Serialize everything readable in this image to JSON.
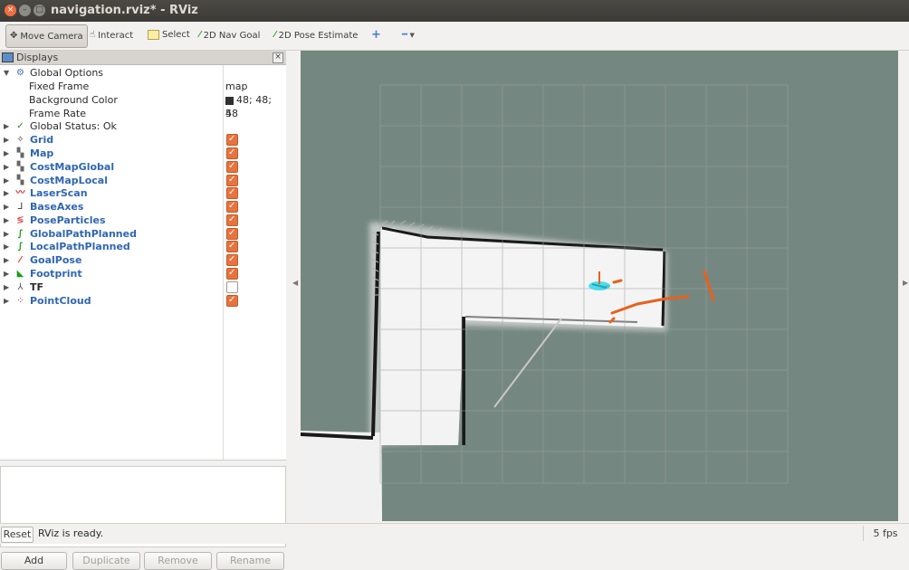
{
  "window": {
    "title": "navigation.rviz* - RViz"
  },
  "toolbar": {
    "move_camera": "Move Camera",
    "interact": "Interact",
    "select": "Select",
    "nav_goal": "2D Nav Goal",
    "pose_estimate": "2D Pose Estimate"
  },
  "panel": {
    "title": "Displays",
    "global_options": {
      "label": "Global Options",
      "fixed_frame_label": "Fixed Frame",
      "fixed_frame_value": "map",
      "bg_color_label": "Background Color",
      "bg_color_value": "48; 48; 48",
      "frame_rate_label": "Frame Rate",
      "frame_rate_value": "5"
    },
    "global_status": "Global Status: Ok",
    "displays": [
      {
        "label": "Grid",
        "checked": true
      },
      {
        "label": "Map",
        "checked": true
      },
      {
        "label": "CostMapGlobal",
        "checked": true
      },
      {
        "label": "CostMapLocal",
        "checked": true
      },
      {
        "label": "LaserScan",
        "checked": true
      },
      {
        "label": "BaseAxes",
        "checked": true
      },
      {
        "label": "PoseParticles",
        "checked": true
      },
      {
        "label": "GlobalPathPlanned",
        "checked": true
      },
      {
        "label": "LocalPathPlanned",
        "checked": true
      },
      {
        "label": "GoalPose",
        "checked": true
      },
      {
        "label": "Footprint",
        "checked": true
      },
      {
        "label": "TF",
        "checked": false
      },
      {
        "label": "PointCloud",
        "checked": true
      }
    ],
    "buttons": {
      "add": "Add",
      "duplicate": "Duplicate",
      "remove": "Remove",
      "rename": "Rename"
    }
  },
  "statusbar": {
    "reset": "Reset",
    "message": "RViz is ready.",
    "fps": "5 fps"
  },
  "colors": {
    "accent": "#e8733e",
    "view_bg": "#758781",
    "map_free": "#f4f4f4",
    "display_label": "#2f66b3"
  }
}
